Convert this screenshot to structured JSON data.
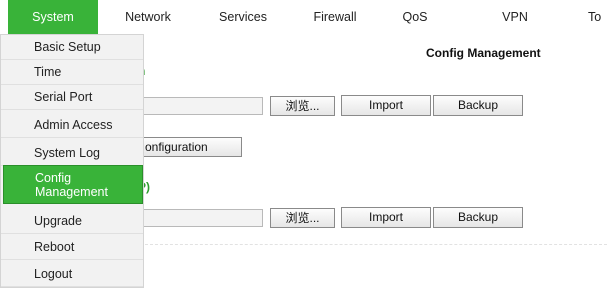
{
  "nav": {
    "tabs": [
      "System",
      "Network",
      "Services",
      "Firewall",
      "QoS",
      "VPN",
      "To"
    ],
    "active_color": "#39b339"
  },
  "page": {
    "heading": "Config Management",
    "section1_title": "n",
    "section2_title": "P)",
    "browse_label": "浏览...",
    "import_label": "Import",
    "backup_label": "Backup",
    "restore_label": "onfiguration"
  },
  "menu": {
    "items": [
      "Basic Setup",
      "Time",
      "Serial Port",
      "Admin Access",
      "System Log",
      "Config\nManagement",
      "Upgrade",
      "Reboot",
      "Logout"
    ],
    "active_index": 5
  }
}
